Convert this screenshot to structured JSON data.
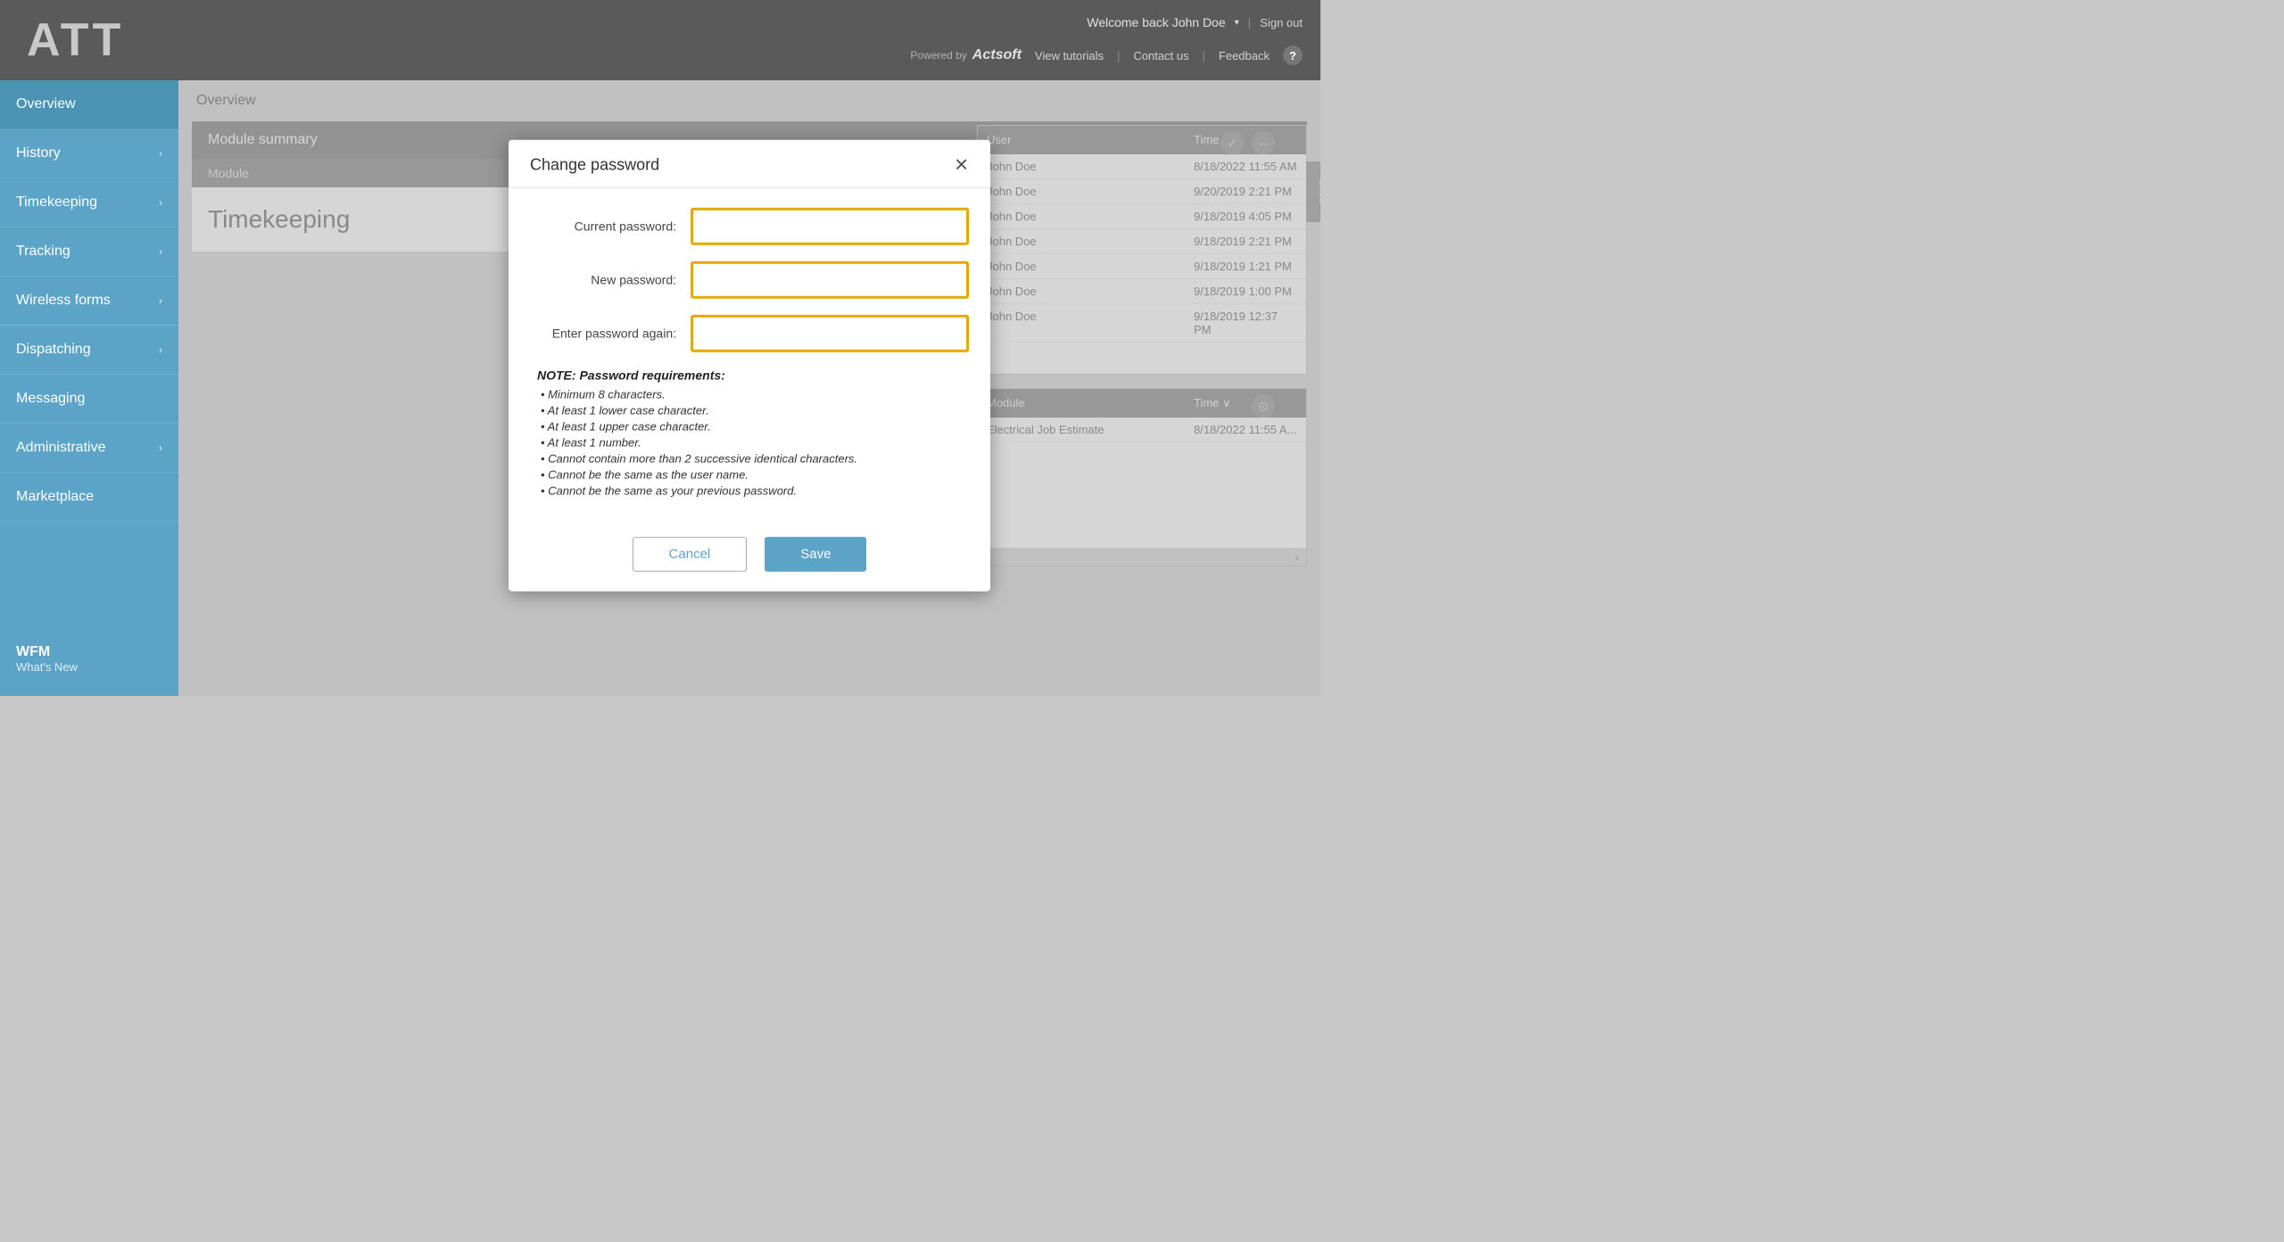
{
  "app": {
    "title": "ATT"
  },
  "header": {
    "welcome": "Welcome back John Doe",
    "dropdown_arrow": "▾",
    "sign_out": "Sign out",
    "powered_by": "Powered by",
    "logo": "Actsoft",
    "view_tutorials": "View tutorials",
    "contact_us": "Contact us",
    "feedback": "Feedback",
    "help": "?"
  },
  "sidebar": {
    "items": [
      {
        "label": "Overview",
        "has_chevron": false,
        "active": true
      },
      {
        "label": "History",
        "has_chevron": true,
        "active": false
      },
      {
        "label": "Timekeeping",
        "has_chevron": true,
        "active": false
      },
      {
        "label": "Tracking",
        "has_chevron": true,
        "active": false
      },
      {
        "label": "Wireless forms",
        "has_chevron": true,
        "active": false
      },
      {
        "label": "Dispatching",
        "has_chevron": true,
        "active": false
      },
      {
        "label": "Messaging",
        "has_chevron": false,
        "active": false
      },
      {
        "label": "Administrative",
        "has_chevron": true,
        "active": false
      },
      {
        "label": "Marketplace",
        "has_chevron": false,
        "active": false
      }
    ],
    "footer": {
      "wfm": "WFM",
      "whats_new": "What's New"
    }
  },
  "breadcrumb": "Overview",
  "module_summary": {
    "header": "Module summary",
    "col_module": "Module",
    "col_user": "User",
    "col_time": "Time",
    "module_name": "Timekeeping"
  },
  "right_panel_top": {
    "col_user": "User",
    "col_time": "Time",
    "sort_arrow": "∨",
    "show_label": "Show",
    "rows": [
      {
        "user": "John Doe",
        "time": "8/18/2022 11:55 AM"
      },
      {
        "user": "John Doe",
        "time": "9/20/2019 2:21 PM"
      },
      {
        "user": "John Doe",
        "time": "9/18/2019 4:05 PM"
      },
      {
        "user": "John Doe",
        "time": "9/18/2019 2:21 PM"
      },
      {
        "user": "John Doe",
        "time": "9/18/2019 1:21 PM"
      },
      {
        "user": "John Doe",
        "time": "9/18/2019 1:00 PM"
      },
      {
        "user": "John Doe",
        "time": "9/18/2019 12:37 PM"
      }
    ]
  },
  "right_panel_bottom": {
    "col_module": "Module",
    "col_time": "Time",
    "sort_arrow": "∨",
    "rows": [
      {
        "module": "Electrical Job Estimate",
        "time": "8/18/2022 11:55 A..."
      }
    ]
  },
  "modal": {
    "title": "Change password",
    "close_icon": "✕",
    "current_password_label": "Current password:",
    "new_password_label": "New password:",
    "confirm_password_label": "Enter password again:",
    "requirements_note": "NOTE: Password requirements:",
    "requirements": [
      "• Minimum 8 characters.",
      "• At least 1 lower case character.",
      "• At least 1 upper case character.",
      "• At least 1 number.",
      "• Cannot contain more than 2 successive identical characters.",
      "• Cannot be the same as the user name.",
      "• Cannot be the same as your previous password."
    ],
    "cancel_label": "Cancel",
    "save_label": "Save"
  }
}
